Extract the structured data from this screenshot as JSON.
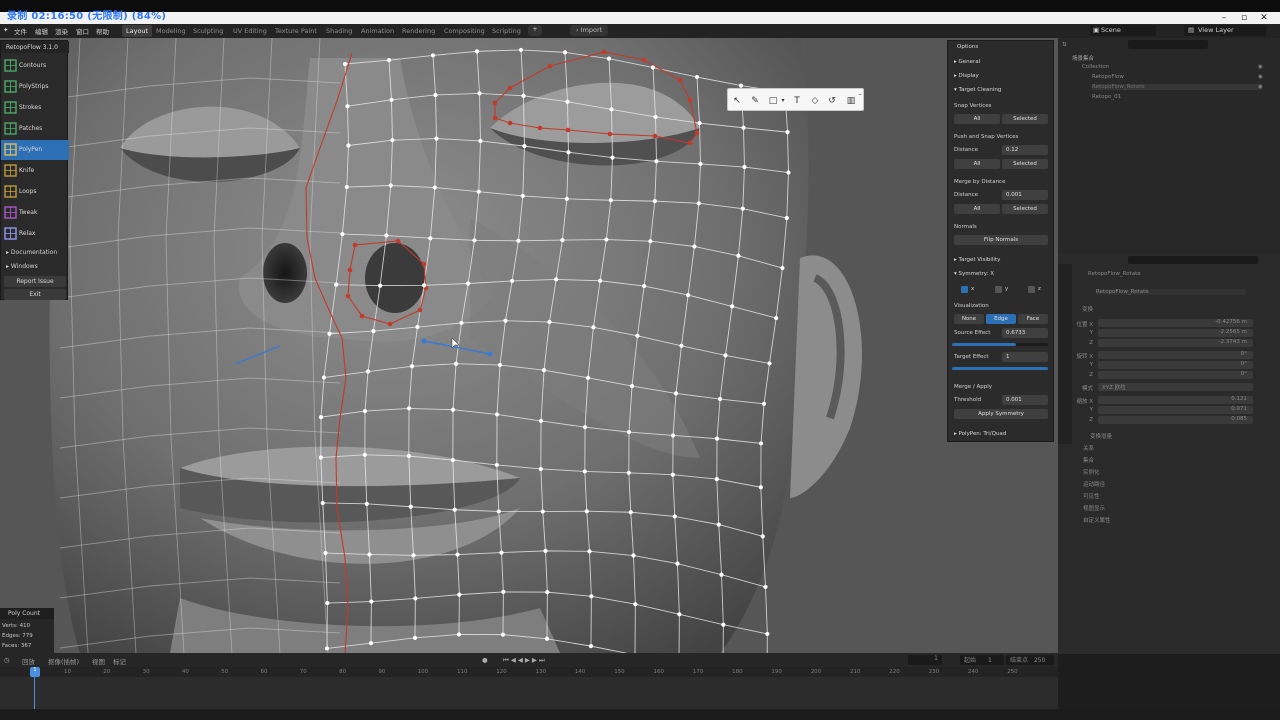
{
  "recorder": {
    "text": "录制 02:16:50 (无限制) (84%)"
  },
  "menu": [
    "文件",
    "编辑",
    "渲染",
    "窗口",
    "帮助"
  ],
  "workspaces": [
    "Layout",
    "Modeling",
    "Sculpting",
    "UV Editing",
    "Texture Paint",
    "Shading",
    "Animation",
    "Rendering",
    "Compositing",
    "Scripting"
  ],
  "active_workspace": "Layout",
  "import_label": "Import",
  "scene_label": "Scene",
  "view_layer_label": "View Layer",
  "toolpanel": {
    "title": "RetopoFlow 3.1.0",
    "tools": [
      {
        "label": "Contours",
        "icon": "contours-icon",
        "active": false
      },
      {
        "label": "PolyStrips",
        "icon": "polystrips-icon",
        "active": false
      },
      {
        "label": "Strokes",
        "icon": "strokes-icon",
        "active": false
      },
      {
        "label": "Patches",
        "icon": "patches-icon",
        "active": false
      },
      {
        "label": "PolyPen",
        "icon": "polypen-icon",
        "active": true
      },
      {
        "label": "Knife",
        "icon": "knife-icon",
        "active": false
      },
      {
        "label": "Loops",
        "icon": "loops-icon",
        "active": false
      },
      {
        "label": "Tweak",
        "icon": "tweak-icon",
        "active": false
      },
      {
        "label": "Relax",
        "icon": "relax-icon",
        "active": false
      }
    ],
    "documentation": "Documentation",
    "windows": "Windows",
    "report_issue": "Report Issue",
    "exit": "Exit"
  },
  "polycount": {
    "title": "Poly Count",
    "verts": "Verts: 410",
    "edges": "Edges: 779",
    "faces": "Faces: 367"
  },
  "options": {
    "title": "Options",
    "general": "General",
    "display": "Display",
    "target_cleaning": "Target Cleaning",
    "snap_vertices": "Snap Vertices",
    "all": "All",
    "selected": "Selected",
    "push_snap": "Push and Snap Vertices",
    "distance_label": "Distance",
    "push_distance": "0.12",
    "merge_by_distance": "Merge by Distance",
    "merge_distance": "0.001",
    "normals": "Normals",
    "flip_normals": "Flip Normals",
    "target_visibility": "Target Visibility",
    "symmetry": "Symmetry: X",
    "sym_x": "x",
    "sym_y": "y",
    "sym_z": "z",
    "visualization": "Visualization",
    "vis_none": "None",
    "vis_edge": "Edge",
    "vis_face": "Face",
    "source_effect_label": "Source Effect",
    "source_effect": "0.6733",
    "target_effect_label": "Target Effect",
    "target_effect": "1",
    "merge_apply": "Merge / Apply",
    "threshold_label": "Threshold",
    "threshold": "0.001",
    "apply_symmetry": "Apply Symmetry",
    "polypen_mode": "PolyPen: Tri/Quad"
  },
  "outliner": {
    "root": "场景集合",
    "collection": "Collection",
    "items": [
      "RetopoFlow",
      "RetopoFlow_Rotate",
      "Retopo_01"
    ]
  },
  "properties": {
    "object_name": "RetopoFlow_Rotate",
    "object_data": "RetopoFlow_Rotate",
    "transform": "变换",
    "location_label": "位置 X",
    "loc_x": "-0.42756 m",
    "loc_y": "-2.2565 m",
    "loc_z": "-2.3743 m",
    "rotation_label": "旋转 X",
    "rot_x": "0°",
    "rot_y": "0°",
    "rot_z": "0°",
    "mode_label": "模式",
    "mode_value": "XYZ 欧拉",
    "scale_label": "缩放 X",
    "scale_x": "0.121",
    "scale_y": "0.071",
    "scale_z": "0.085",
    "y_label": "Y",
    "z_label": "Z",
    "delta": "变换增量",
    "sections": [
      "关系",
      "集合",
      "实例化",
      "运动路径",
      "可见性",
      "视图显示",
      "自定义属性"
    ]
  },
  "timeline": {
    "menus": [
      "回放",
      "抠像(插帧)",
      "视图",
      "标记"
    ],
    "current_frame": "1",
    "start_label": "起始",
    "start": "1",
    "end_label": "结束点",
    "end": "250",
    "ticks": [
      "10",
      "20",
      "30",
      "40",
      "50",
      "60",
      "70",
      "80",
      "90",
      "100",
      "110",
      "120",
      "130",
      "140",
      "150",
      "160",
      "170",
      "180",
      "190",
      "200",
      "210",
      "220",
      "230",
      "240",
      "250"
    ]
  },
  "colors": {
    "accent_blue": "#2d6fb4",
    "mesh_white": "#ffffff",
    "mesh_red": "#c23a2a",
    "viewport_gray": "#4a4a4a"
  }
}
